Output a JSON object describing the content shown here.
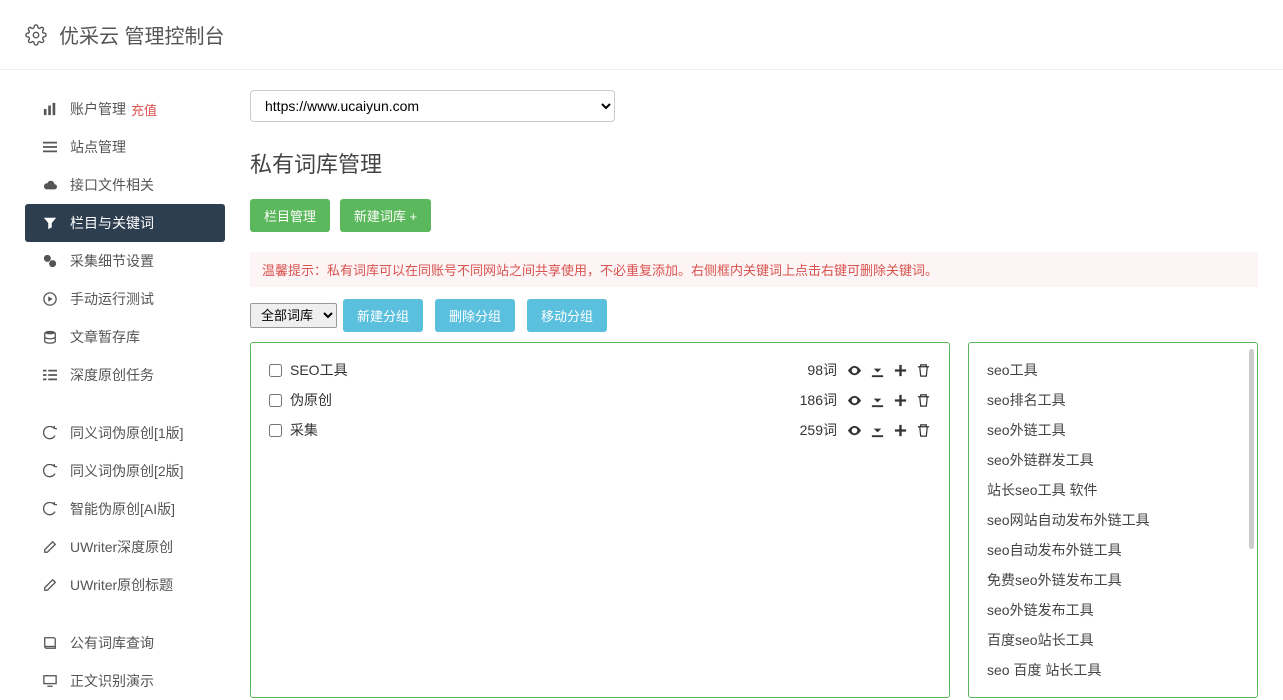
{
  "header": {
    "title": "优采云 管理控制台"
  },
  "sidebar": {
    "items": [
      {
        "label": "账户管理",
        "badge": "充值"
      },
      {
        "label": "站点管理"
      },
      {
        "label": "接口文件相关"
      },
      {
        "label": "栏目与关键词"
      },
      {
        "label": "采集细节设置"
      },
      {
        "label": "手动运行测试"
      },
      {
        "label": "文章暂存库"
      },
      {
        "label": "深度原创任务"
      }
    ],
    "group2": [
      {
        "label": "同义词伪原创[1版]"
      },
      {
        "label": "同义词伪原创[2版]"
      },
      {
        "label": "智能伪原创[AI版]"
      },
      {
        "label": "UWriter深度原创"
      },
      {
        "label": "UWriter原创标题"
      }
    ],
    "group3": [
      {
        "label": "公有词库查询"
      },
      {
        "label": "正文识别演示"
      }
    ]
  },
  "main": {
    "site_url": "https://www.ucaiyun.com",
    "page_title": "私有词库管理",
    "btn_col": "栏目管理",
    "btn_new": "新建词库 +",
    "tip": "温馨提示：私有词库可以在同账号不同网站之间共享使用，不必重复添加。右侧框内关键词上点击右键可删除关键词。",
    "group_select": "全部词库",
    "btn_new_group": "新建分组",
    "btn_del_group": "删除分组",
    "btn_move_group": "移动分组",
    "wordlibs": [
      {
        "name": "SEO工具",
        "count": "98词"
      },
      {
        "name": "伪原创",
        "count": "186词"
      },
      {
        "name": "采集",
        "count": "259词"
      }
    ],
    "keywords": [
      "seo工具",
      "seo排名工具",
      "seo外链工具",
      "seo外链群发工具",
      "站长seo工具 软件",
      "seo网站自动发布外链工具",
      "seo自动发布外链工具",
      "免费seo外链发布工具",
      "seo外链发布工具",
      "百度seo站长工具",
      "seo 百度 站长工具"
    ]
  }
}
